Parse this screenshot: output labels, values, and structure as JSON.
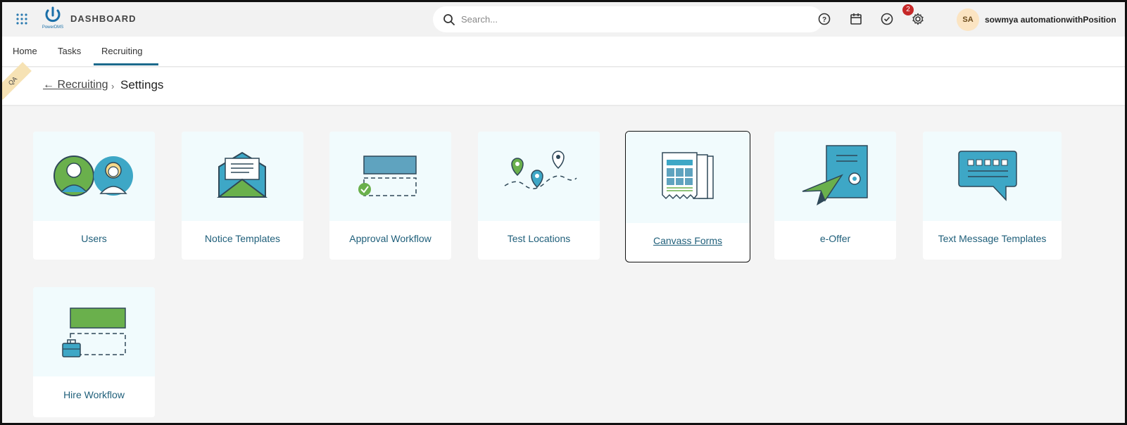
{
  "header": {
    "app_title": "DASHBOARD",
    "logo_text": "PowerDMS",
    "search_placeholder": "Search...",
    "notification_count": "2",
    "user_initials": "SA",
    "user_name": "sowmya automationwithPosition",
    "icons": [
      "apps-grid-icon",
      "help-icon",
      "calendar-icon",
      "tasks-check-icon",
      "settings-icon"
    ]
  },
  "nav": {
    "tabs": [
      {
        "label": "Home"
      },
      {
        "label": "Tasks"
      },
      {
        "label": "Recruiting",
        "active": true
      }
    ]
  },
  "breadcrumb": {
    "ribbon": "QA",
    "back_arrow": "←",
    "back_label": "Recruiting",
    "separator": "›",
    "current": "Settings"
  },
  "cards": [
    {
      "label": "Users",
      "icon": "users-icon"
    },
    {
      "label": "Notice Templates",
      "icon": "envelope-icon"
    },
    {
      "label": "Approval Workflow",
      "icon": "approval-workflow-icon"
    },
    {
      "label": "Test Locations",
      "icon": "map-pins-icon"
    },
    {
      "label": "Canvass Forms",
      "icon": "forms-icon",
      "selected": true
    },
    {
      "label": "e-Offer",
      "icon": "certificate-icon"
    },
    {
      "label": "Text Message Templates",
      "icon": "chat-bubble-icon"
    },
    {
      "label": "Hire Workflow",
      "icon": "hire-workflow-icon"
    }
  ],
  "colors": {
    "accent_text": "#1f5f7a",
    "teal": "#3ea7c6",
    "green": "#6ab04c",
    "card_art_bg": "#f1fbfd",
    "badge": "#c62828"
  }
}
